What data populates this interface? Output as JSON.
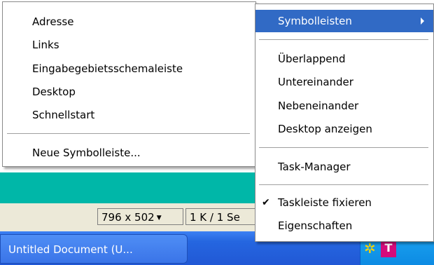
{
  "left_menu": {
    "items": [
      {
        "label": "Adresse"
      },
      {
        "label": "Links"
      },
      {
        "label": "Eingabegebietsschemaleiste"
      },
      {
        "label": "Desktop"
      },
      {
        "label": "Schnellstart"
      },
      {
        "label": "Neue Symbolleiste..."
      }
    ]
  },
  "right_menu": {
    "items": [
      {
        "label": "Symbolleisten",
        "highlighted": true
      },
      {
        "label": "Überlappend"
      },
      {
        "label": "Untereinander"
      },
      {
        "label": "Nebeneinander"
      },
      {
        "label": "Desktop anzeigen"
      },
      {
        "label": "Task-Manager"
      },
      {
        "label": "Taskleiste fixieren",
        "checked": true
      },
      {
        "label": "Eigenschaften"
      }
    ],
    "check_icon": "checkmark-icon",
    "submenu_icon": "triangle-right-icon",
    "highlight_color": "#316ac5"
  },
  "statusbar": {
    "zoom": "796 x 502",
    "size": "1 K / 1 Se",
    "dropdown_icon": "dropdown-arrow-icon"
  },
  "taskbar": {
    "window_button": "Untitled Document (U...",
    "tray_icons": [
      "network-icon",
      "telekom-icon"
    ],
    "color": "#2563e0"
  },
  "background": {
    "accent_color": "#00b7a8"
  }
}
